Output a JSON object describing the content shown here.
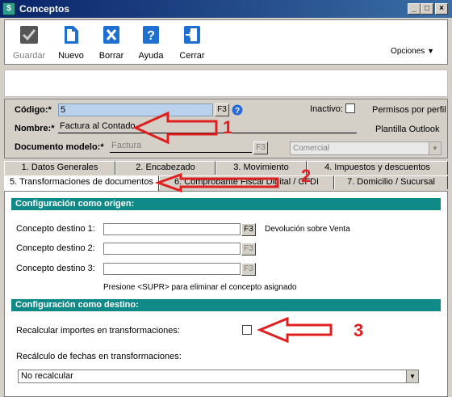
{
  "window": {
    "title": "Conceptos",
    "app_icon_glyph": "$"
  },
  "toolbar": {
    "buttons": [
      {
        "label": "Guardar",
        "icon": "check-icon",
        "disabled": true
      },
      {
        "label": "Nuevo",
        "icon": "new-document-icon"
      },
      {
        "label": "Borrar",
        "icon": "delete-x-icon"
      },
      {
        "label": "Ayuda",
        "icon": "help-icon"
      },
      {
        "label": "Cerrar",
        "icon": "exit-door-icon"
      }
    ],
    "options_label": "Opciones"
  },
  "header": {
    "codigo_label": "Código:*",
    "codigo_value": "5",
    "f3": "F3",
    "nombre_label": "Nombre:*",
    "nombre_value": "Factura al Contado",
    "documento_label": "Documento modelo:*",
    "documento_value": "Factura",
    "inactivo_label": "Inactivo:",
    "permisos_label": "Permisos por perfil",
    "plantilla_label": "Plantilla Outlook",
    "combo_value": "Comercial"
  },
  "tabs_row1": [
    {
      "label": "1. Datos Generales"
    },
    {
      "label": "2. Encabezado"
    },
    {
      "label": "3. Movimiento"
    },
    {
      "label": "4. Impuestos y descuentos"
    }
  ],
  "tabs_row2": [
    {
      "label": "5. Transformaciones de documentos",
      "active": true
    },
    {
      "label": "6. Comprobante Fiscal Digital / CFDI"
    },
    {
      "label": "7. Domicilio / Sucursal"
    }
  ],
  "origin": {
    "title": "Configuración como origen:",
    "dest1_label": "Concepto destino 1:",
    "dest1_desc": "Devolución sobre Venta",
    "dest2_label": "Concepto destino 2:",
    "dest3_label": "Concepto destino 3:",
    "hint": "Presione <SUPR> para eliminar el concepto asignado"
  },
  "destination": {
    "title": "Configuración como destino:",
    "recalc_importes_label": "Recalcular importes en transformaciones:",
    "recalc_fechas_label": "Recálculo de fechas en transformaciones:",
    "recalc_fechas_value": "No recalcular"
  },
  "annotations": [
    "1",
    "2",
    "3"
  ],
  "colors": {
    "titlebar": "#0a246a",
    "section_bar": "#0f8a88",
    "annotation": "#e02020"
  }
}
